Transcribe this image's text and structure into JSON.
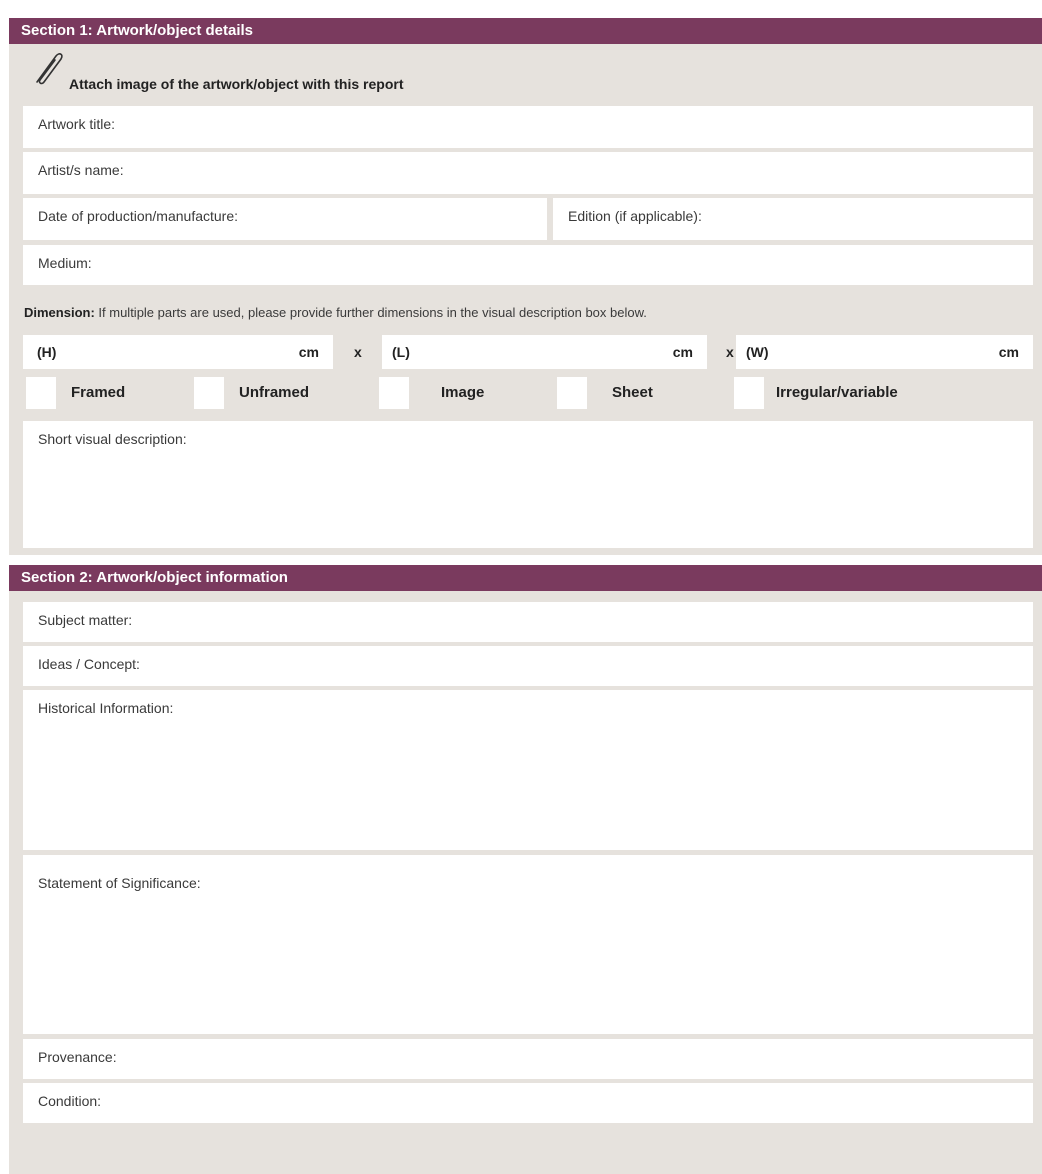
{
  "section1": {
    "title": "Section 1: Artwork/object details",
    "attach_text": "Attach image of the artwork/object with this report",
    "fields": {
      "artwork_title": "Artwork title:",
      "artist_name": "Artist/s name:",
      "date": "Date of production/manufacture:",
      "edition": "Edition (if applicable):",
      "medium": "Medium:"
    },
    "dimension": {
      "label": "Dimension:",
      "note": " If multiple parts are used, please provide further dimensions in the visual description box below.",
      "height": "(H)",
      "length": "(L)",
      "width": "(W)",
      "unit": "cm",
      "times": "x"
    },
    "checkboxes": [
      "Framed",
      "Unframed",
      "Image",
      "Sheet",
      "Irregular/variable"
    ],
    "short_visual": "Short visual description:"
  },
  "section2": {
    "title": "Section 2: Artwork/object information",
    "fields": {
      "subject": "Subject matter:",
      "ideas": "Ideas / Concept:",
      "historical": "Historical Information:",
      "significance": "Statement of Significance:",
      "provenance": "Provenance:",
      "condition": "Condition:"
    }
  },
  "colors": {
    "header": "#7a3a5e",
    "panel": "#e6e2dd",
    "field": "#ffffff"
  },
  "icons": {
    "attach": "paperclip-icon"
  }
}
